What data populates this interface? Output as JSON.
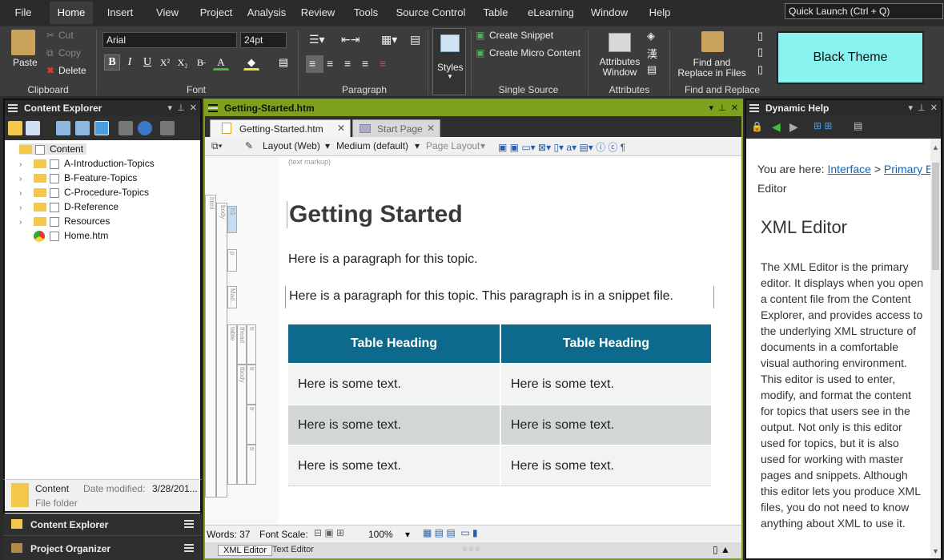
{
  "menu": {
    "items": [
      "File",
      "Home",
      "Insert",
      "View",
      "Project",
      "Analysis",
      "Review",
      "Tools",
      "Source Control",
      "Table",
      "eLearning",
      "Window",
      "Help"
    ],
    "active": "Home",
    "quick_launch": "Quick Launch (Ctrl + Q)"
  },
  "ribbon": {
    "clipboard": {
      "paste": "Paste",
      "cut": "Cut",
      "copy": "Copy",
      "delete": "Delete",
      "label": "Clipboard"
    },
    "font": {
      "family": "Arial",
      "size": "24pt",
      "label": "Font"
    },
    "paragraph": {
      "label": "Paragraph"
    },
    "styles": {
      "label": "Styles"
    },
    "single_source": {
      "create_snippet": "Create Snippet",
      "create_micro": "Create Micro Content",
      "label": "Single Source"
    },
    "attributes": {
      "button": "Attributes Window",
      "label": "Attributes"
    },
    "find": {
      "button_line1": "Find and",
      "button_line2": "Replace in Files",
      "label": "Find and Replace"
    },
    "theme_button": "Black Theme"
  },
  "content_explorer": {
    "title": "Content Explorer",
    "root": "Content",
    "items": [
      "A-Introduction-Topics",
      "B-Feature-Topics",
      "C-Procedure-Topics",
      "D-Reference",
      "Resources",
      "Home.htm"
    ],
    "details": {
      "name": "Content",
      "date_label": "Date modified:",
      "date": "3/28/201...",
      "type": "File folder"
    },
    "bottom_tabs": [
      "Content Explorer",
      "Project Organizer"
    ]
  },
  "editor": {
    "title": "Getting-Started.htm",
    "tabs": [
      "Getting-Started.htm",
      "Start Page"
    ],
    "toolbar": {
      "layout": "Layout (Web)",
      "medium": "Medium (default)",
      "page_layout": "Page Layout"
    },
    "markup_hint": "(text markup)",
    "structure_tags": [
      "html",
      "body",
      "h1",
      "p",
      "Mad...",
      "table",
      "thead",
      "tr",
      "tbody",
      "tr",
      "tr",
      "tr"
    ],
    "heading": "Getting Started",
    "para1": "Here is a paragraph for this topic.",
    "para2": "Here is a paragraph for this topic. This paragraph is in a snippet file.",
    "table": {
      "headers": [
        "Table Heading",
        "Table Heading"
      ],
      "rows": [
        [
          "Here is some text.",
          "Here is some text."
        ],
        [
          "Here is some text.",
          "Here is some text."
        ],
        [
          "Here is some text.",
          "Here is some text."
        ]
      ]
    },
    "status": {
      "words": "Words: 37",
      "font_scale": "Font Scale:",
      "zoom": "100%"
    },
    "bottom_tabs": [
      "XML Editor",
      "Text Editor"
    ],
    "bottom_dots": "○ ○ ○"
  },
  "dynamic_help": {
    "title": "Dynamic Help",
    "breadcrumb_prefix": "You are here:",
    "link1": "Interface",
    "sep": ">",
    "link2": "Primary E",
    "breadcrumb_tail": "Editor",
    "heading": "XML Editor",
    "body": "The XML Editor is the primary editor. It displays when you open a content file from the Content Explorer, and provides access to the underlying XML structure of documents in a comfortable visual authoring environment. This editor is used to enter, modify, and format the content for topics that users see in the output. Not only is this editor used for topics, but it is also used for working with master pages and snippets. Although this editor lets you produce XML files, you do not need to know anything about XML to use it."
  },
  "colors": {
    "accent_green": "#7ea11d",
    "table_head": "#0e6a8c",
    "theme_button": "#89f3f0"
  }
}
